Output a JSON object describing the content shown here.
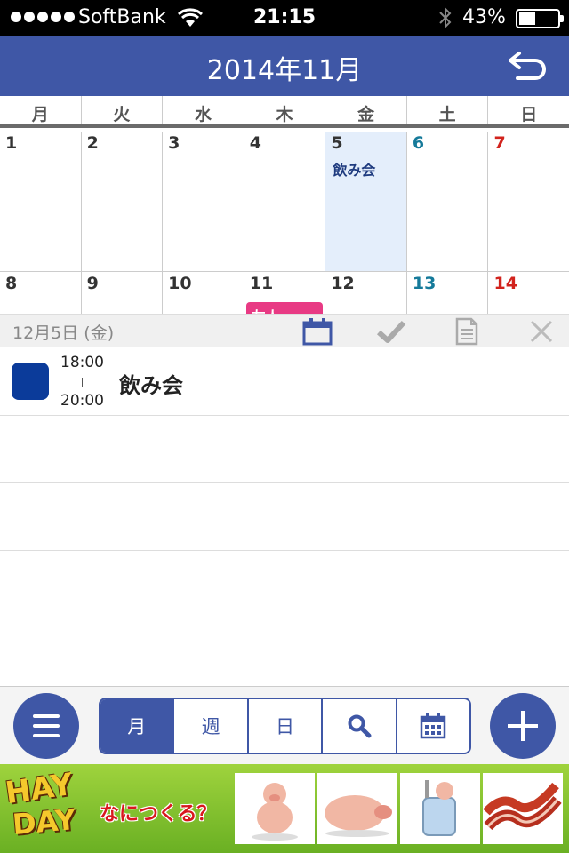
{
  "status": {
    "carrier": "SoftBank",
    "time": "21:15",
    "battery_percent": "43%",
    "battery_level": 0.43
  },
  "header": {
    "title": "2014年11月"
  },
  "weekdays": [
    "月",
    "火",
    "水",
    "木",
    "金",
    "土",
    "日"
  ],
  "calendar": {
    "week1": [
      "1",
      "2",
      "3",
      "4",
      "5",
      "6",
      "7"
    ],
    "week2": [
      "8",
      "9",
      "10",
      "11",
      "12",
      "13",
      "14"
    ],
    "events": {
      "day5": "飲み会",
      "day11": "友人"
    }
  },
  "datebar": {
    "date": "12月5日 (金)"
  },
  "schedule": {
    "items": [
      {
        "start": "18:00",
        "end": "20:00",
        "title": "飲み会",
        "color": "#0b3b9a"
      }
    ]
  },
  "bottombar": {
    "tabs": [
      "月",
      "週",
      "日"
    ]
  },
  "ad": {
    "logo_line1": "HAY",
    "logo_line2": "DAY",
    "copy": "なにつくる？"
  },
  "colors": {
    "primary": "#3f57a6",
    "saturday": "#157a9a",
    "sunday": "#d2231d",
    "selected_bg": "#e4eefb",
    "event_pink": "#e83a84"
  }
}
